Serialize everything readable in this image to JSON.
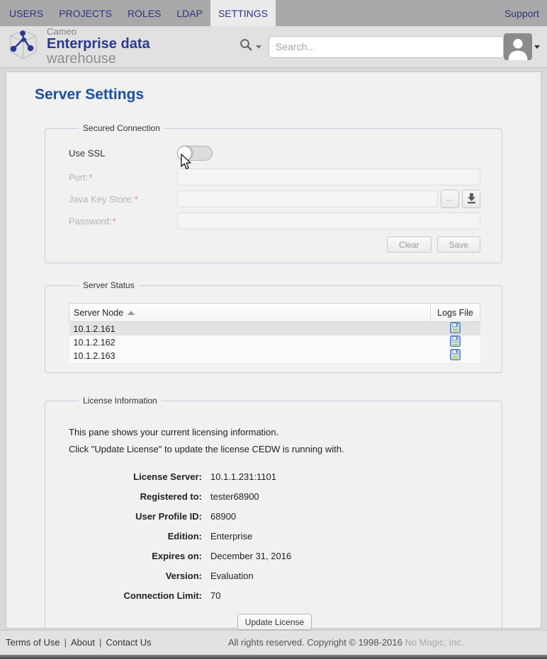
{
  "nav": {
    "items": [
      {
        "label": "USERS"
      },
      {
        "label": "PROJECTS"
      },
      {
        "label": "ROLES"
      },
      {
        "label": "LDAP"
      },
      {
        "label": "SETTINGS"
      }
    ],
    "active_item": "SETTINGS",
    "support_label": "Support"
  },
  "header": {
    "brand_line1": "Cameo",
    "brand_line2_strong": "Enterprise data",
    "brand_line2_light": "warehouse",
    "search_placeholder": "Search..."
  },
  "page": {
    "title": "Server Settings"
  },
  "secured_connection": {
    "legend": "Secured Connection",
    "use_ssl_label": "Use SSL",
    "ssl_enabled": false,
    "fields": [
      {
        "label": "Port:",
        "required": "*",
        "value": ""
      },
      {
        "label": "Java Key Store:",
        "required": "*",
        "value": ""
      },
      {
        "label": "Password:",
        "required": "*",
        "value": ""
      }
    ],
    "browse_label": "...",
    "clear_label": "Clear",
    "save_label": "Save"
  },
  "server_status": {
    "legend": "Server Status",
    "columns": {
      "node": "Server Node",
      "logs": "Logs File"
    },
    "sort": "ascending",
    "rows": [
      "10.1.2.161",
      "10.1.2.162",
      "10.1.2.163"
    ]
  },
  "license": {
    "legend": "License Information",
    "intro1": "This pane shows your current licensing information.",
    "intro2": "Click \"Update License\" to update the license CEDW is running with.",
    "fields": [
      {
        "label": "License Server:",
        "value": "10.1.1.231:1101"
      },
      {
        "label": "Registered to:",
        "value": "tester68900"
      },
      {
        "label": "User Profile ID:",
        "value": "68900"
      },
      {
        "label": "Edition:",
        "value": "Enterprise"
      },
      {
        "label": "Expires on:",
        "value": "December 31, 2016"
      },
      {
        "label": "Version:",
        "value": "Evaluation"
      },
      {
        "label": "Connection Limit:",
        "value": "70"
      }
    ],
    "update_button": "Update License"
  },
  "footer": {
    "links": [
      {
        "label": "Terms of Use"
      },
      {
        "label": "About"
      },
      {
        "label": "Contact Us"
      }
    ],
    "separator": "|",
    "copyright": "All rights reserved. Copyright © 1998-2016 ",
    "company": "No Magic, Inc."
  },
  "colors": {
    "brand_navy": "#2b3990",
    "title_blue": "#1b4fa0",
    "nav_gray": "#a9a9a9",
    "required_red": "#ee8888",
    "floppy_blue": "#4a74b8",
    "floppy_green": "#7fbf4d"
  }
}
